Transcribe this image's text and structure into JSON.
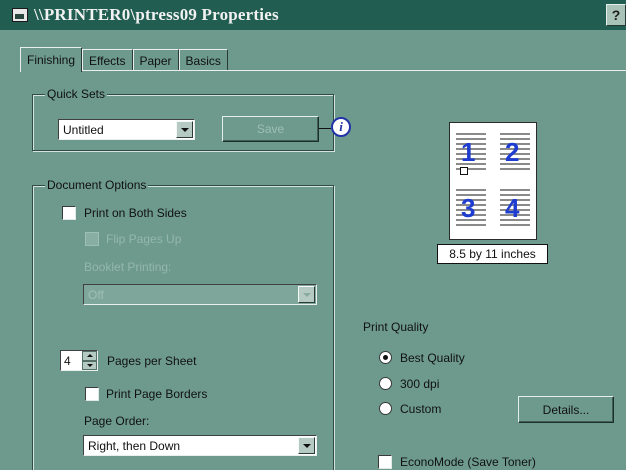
{
  "window": {
    "title": "\\\\PRINTER0\\ptress09 Properties",
    "help_label": "?"
  },
  "tabs": [
    {
      "label": "Finishing",
      "active": true
    },
    {
      "label": "Effects",
      "active": false
    },
    {
      "label": "Paper",
      "active": false
    },
    {
      "label": "Basics",
      "active": false
    }
  ],
  "quick_sets": {
    "group_label": "Quick Sets",
    "select_value": "Untitled",
    "save_button_label": "Save",
    "info_icon": "i"
  },
  "document_options": {
    "group_label": "Document Options",
    "print_both_sides": {
      "label": "Print on Both Sides",
      "checked": false
    },
    "flip_pages_up": {
      "label": "Flip Pages Up",
      "checked": false,
      "disabled": true
    },
    "booklet_printing": {
      "label": "Booklet Printing:",
      "value": "Off",
      "disabled": true
    },
    "pages_per_sheet": {
      "value": "4",
      "label": "Pages per Sheet"
    },
    "print_page_borders": {
      "label": "Print Page Borders",
      "checked": false
    },
    "page_order": {
      "label": "Page Order:",
      "value": "Right, then Down"
    }
  },
  "preview": {
    "caption": "8.5 by 11 inches",
    "page_numbers": [
      "1",
      "2",
      "3",
      "4"
    ]
  },
  "print_quality": {
    "label": "Print Quality",
    "options": [
      {
        "label": "Best Quality",
        "selected": true
      },
      {
        "label": "300 dpi",
        "selected": false
      },
      {
        "label": "Custom",
        "selected": false
      }
    ],
    "details_button_label": "Details...",
    "economode": {
      "label": "EconoMode (Save Toner)",
      "checked": false
    }
  },
  "colors": {
    "dialog_bg": "#6d9a8c",
    "titlebar_bg": "#215d50",
    "preview_number": "#1e3ccf"
  }
}
